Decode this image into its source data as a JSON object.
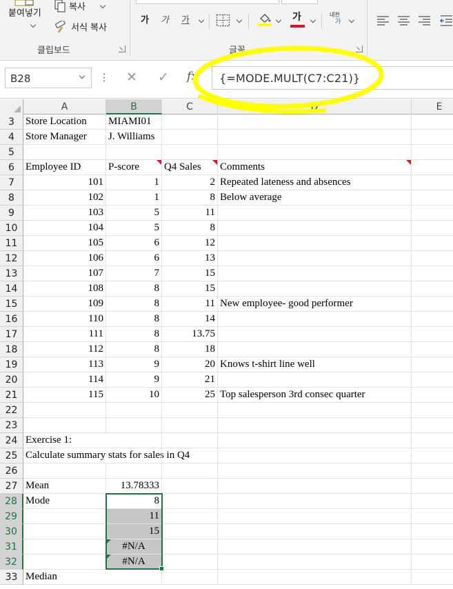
{
  "ribbon": {
    "clipboard": {
      "paste_label": "붙여넣기",
      "copy_label": "복사",
      "format_painter_label": "서식 복사",
      "group_label": "클립보드"
    },
    "font": {
      "bold_label": "가",
      "grow_font_label": "가",
      "underline_label": "가",
      "font_color_label": "가",
      "phonetic_label_top": "내천",
      "phonetic_label_bottom": "가",
      "group_label": "글꼴",
      "fill_color": "#FFFF00",
      "font_color": "#E81123"
    }
  },
  "formula_bar": {
    "name_box": "B28",
    "cancel_glyph": "✕",
    "enter_glyph": "✓",
    "fx_label": "fx",
    "formula": "{=MODE.MULT(C7:C21)}"
  },
  "sheet": {
    "columns": [
      "A",
      "B",
      "C",
      "D",
      "E"
    ],
    "rows": [
      {
        "num": "3",
        "a": "Store Location",
        "b": "MIAMI01",
        "c": "",
        "d": ""
      },
      {
        "num": "4",
        "a": "Store Manager",
        "b": "J. Williams",
        "c": "",
        "d": ""
      },
      {
        "num": "5",
        "a": "",
        "b": "",
        "c": "",
        "d": ""
      },
      {
        "num": "6",
        "a": "Employee ID",
        "b": "P-score",
        "c": "Q4 Sales",
        "d": "Comments"
      },
      {
        "num": "7",
        "a": "101",
        "b": "1",
        "c": "2",
        "d": "Repeated lateness and absences"
      },
      {
        "num": "8",
        "a": "102",
        "b": "1",
        "c": "8",
        "d": "Below average"
      },
      {
        "num": "9",
        "a": "103",
        "b": "5",
        "c": "11",
        "d": ""
      },
      {
        "num": "10",
        "a": "104",
        "b": "5",
        "c": "8",
        "d": ""
      },
      {
        "num": "11",
        "a": "105",
        "b": "6",
        "c": "12",
        "d": ""
      },
      {
        "num": "12",
        "a": "106",
        "b": "6",
        "c": "13",
        "d": ""
      },
      {
        "num": "13",
        "a": "107",
        "b": "7",
        "c": "15",
        "d": ""
      },
      {
        "num": "14",
        "a": "108",
        "b": "8",
        "c": "15",
        "d": ""
      },
      {
        "num": "15",
        "a": "109",
        "b": "8",
        "c": "11",
        "d": "New employee- good performer"
      },
      {
        "num": "16",
        "a": "110",
        "b": "8",
        "c": "14",
        "d": ""
      },
      {
        "num": "17",
        "a": "111",
        "b": "8",
        "c": "13.75",
        "d": ""
      },
      {
        "num": "18",
        "a": "112",
        "b": "8",
        "c": "18",
        "d": ""
      },
      {
        "num": "19",
        "a": "113",
        "b": "9",
        "c": "20",
        "d": "Knows t-shirt line well"
      },
      {
        "num": "20",
        "a": "114",
        "b": "9",
        "c": "21",
        "d": ""
      },
      {
        "num": "21",
        "a": "115",
        "b": "10",
        "c": "25",
        "d": "Top salesperson 3rd consec quarter"
      },
      {
        "num": "22",
        "a": "",
        "b": "",
        "c": "",
        "d": ""
      },
      {
        "num": "23",
        "a": "",
        "b": "",
        "c": "",
        "d": ""
      },
      {
        "num": "24",
        "a": "Exercise 1:",
        "b": "",
        "c": "",
        "d": ""
      },
      {
        "num": "25",
        "a": "Calculate summary stats for sales in Q4",
        "b": "",
        "c": "",
        "d": ""
      },
      {
        "num": "26",
        "a": "",
        "b": "",
        "c": "",
        "d": ""
      },
      {
        "num": "27",
        "a": "Mean",
        "b": "13.78333",
        "c": "",
        "d": ""
      },
      {
        "num": "28",
        "a": "Mode",
        "b": "8",
        "c": "",
        "d": ""
      },
      {
        "num": "29",
        "a": "",
        "b": "11",
        "c": "",
        "d": ""
      },
      {
        "num": "30",
        "a": "",
        "b": "15",
        "c": "",
        "d": ""
      },
      {
        "num": "31",
        "a": "",
        "b": "#N/A",
        "c": "",
        "d": ""
      },
      {
        "num": "32",
        "a": "",
        "b": "#N/A",
        "c": "",
        "d": ""
      },
      {
        "num": "33",
        "a": "Median",
        "b": "",
        "c": "",
        "d": ""
      }
    ]
  },
  "colors": {
    "excel_green": "#217346",
    "annotation_yellow": "#FFFF00",
    "comment_indicator": "#E81123",
    "array_highlight": "#C6C6C6"
  }
}
